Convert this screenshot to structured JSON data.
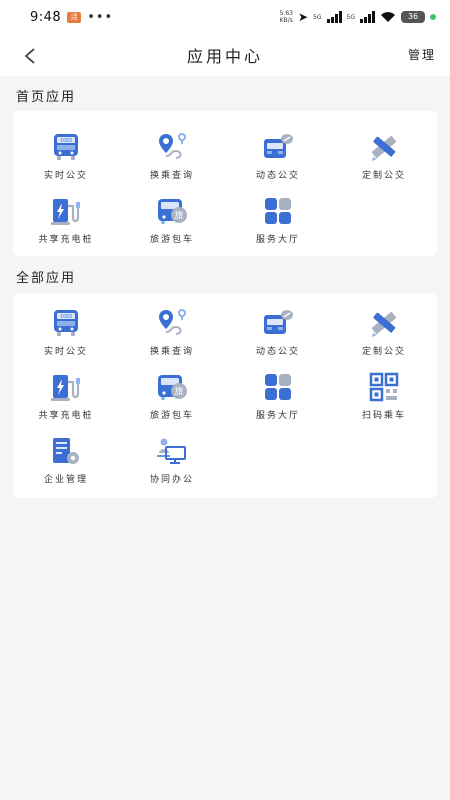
{
  "status_bar": {
    "time": "9:48",
    "app_badge": "活",
    "more": "•••",
    "speed_value": "5.63",
    "speed_unit": "KB/s",
    "network_1": "5G",
    "network_2": "5G",
    "battery": "36"
  },
  "nav": {
    "title": "应用中心",
    "manage_label": "管理"
  },
  "home_section": {
    "title": "首页应用",
    "apps": [
      {
        "label": "实时公交",
        "icon": "bus-realtime-icon"
      },
      {
        "label": "换乘查询",
        "icon": "route-pin-icon"
      },
      {
        "label": "动态公交",
        "icon": "bus-dynamic-icon"
      },
      {
        "label": "定制公交",
        "icon": "pencil-ruler-icon"
      },
      {
        "label": "共享充电桩",
        "icon": "charging-pile-icon"
      },
      {
        "label": "旅游包车",
        "icon": "tour-bus-icon"
      },
      {
        "label": "服务大厅",
        "icon": "grid-blocks-icon"
      }
    ]
  },
  "all_section": {
    "title": "全部应用",
    "apps": [
      {
        "label": "实时公交",
        "icon": "bus-realtime-icon"
      },
      {
        "label": "换乘查询",
        "icon": "route-pin-icon"
      },
      {
        "label": "动态公交",
        "icon": "bus-dynamic-icon"
      },
      {
        "label": "定制公交",
        "icon": "pencil-ruler-icon"
      },
      {
        "label": "共享充电桩",
        "icon": "charging-pile-icon"
      },
      {
        "label": "旅游包车",
        "icon": "tour-bus-icon"
      },
      {
        "label": "服务大厅",
        "icon": "grid-blocks-icon"
      },
      {
        "label": "扫码乘车",
        "icon": "qr-code-icon"
      },
      {
        "label": "企业管理",
        "icon": "building-gear-icon"
      },
      {
        "label": "协同办公",
        "icon": "person-desk-icon"
      }
    ]
  },
  "icon_text": {
    "bus_display": "1683",
    "tour_char": "旅"
  },
  "colors": {
    "primary_blue": "#3b6fd4",
    "light_blue": "#8fb0ea",
    "gray": "#a7b1c2",
    "background": "#f5f5f5",
    "card": "#ffffff"
  }
}
